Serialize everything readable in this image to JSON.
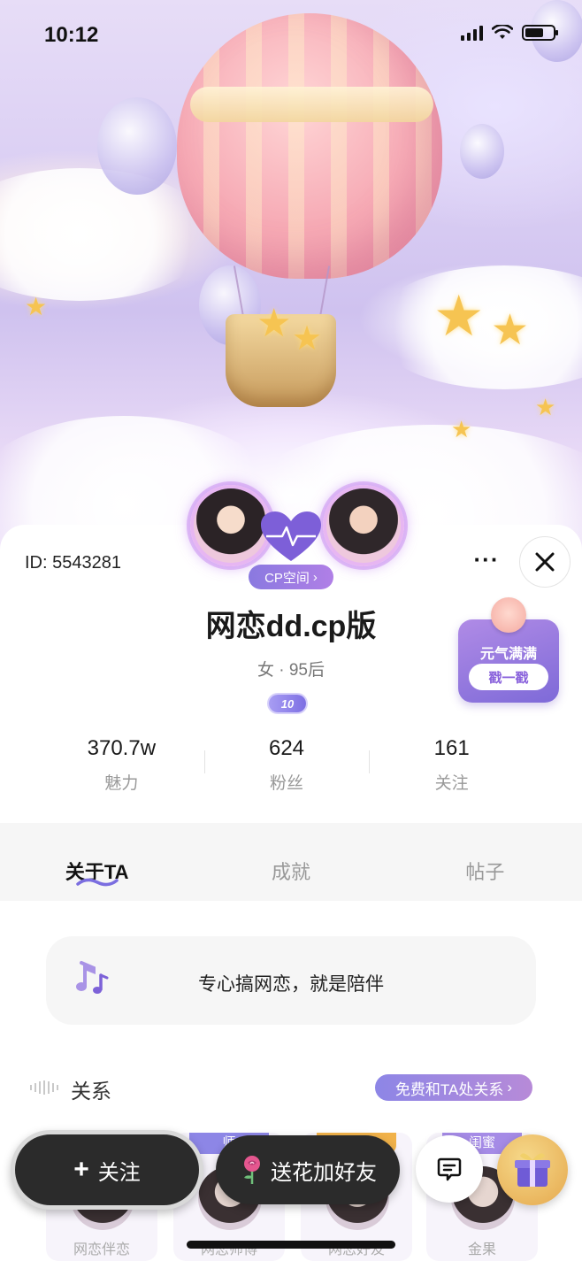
{
  "status_bar": {
    "time": "10:12"
  },
  "profile": {
    "id_text": "ID: 5543281",
    "cp_space_label": "CP空间",
    "cp_space_arrow": "›",
    "nickname": "网恋dd.cp版",
    "sub_info": "女 · 95后",
    "level": "10",
    "more_label": "···"
  },
  "energy_card": {
    "title": "元气满满",
    "button_label": "戳一戳"
  },
  "stats": [
    {
      "value": "370.7w",
      "label": "魅力"
    },
    {
      "value": "624",
      "label": "粉丝"
    },
    {
      "value": "161",
      "label": "关注"
    }
  ],
  "tabs": [
    {
      "label": "关于TA",
      "active": true
    },
    {
      "label": "成就",
      "active": false
    },
    {
      "label": "帖子",
      "active": false
    }
  ],
  "signature": {
    "text": "专心搞网恋，就是陪伴"
  },
  "relations": {
    "title": "关系",
    "cta_label": "免费和TA处关系",
    "cta_arrow": "›",
    "cards": [
      {
        "tag": "",
        "tag_color": "#e86a86",
        "name": "网恋伴恋"
      },
      {
        "tag": "师",
        "tag_color": "#8d86e6",
        "name": "网恋师傅"
      },
      {
        "tag": "",
        "tag_color": "#f1b24a",
        "name": "网恋好友"
      },
      {
        "tag": "闺蜜",
        "tag_color": "#a58be6",
        "name": "金果"
      }
    ]
  },
  "actions": {
    "follow_icon": "+",
    "follow_label": "关注",
    "flower_label": "送花加好友"
  },
  "colors": {
    "accent": "#8a79e0",
    "button_dark": "#2b2b2b",
    "card_bg": "#f6f6f6"
  },
  "icons": {
    "close": "close-icon",
    "more": "more-icon",
    "music": "music-note-icon",
    "message": "message-icon",
    "gift": "gift-icon",
    "rose": "rose-icon",
    "heart": "heart-icon"
  }
}
